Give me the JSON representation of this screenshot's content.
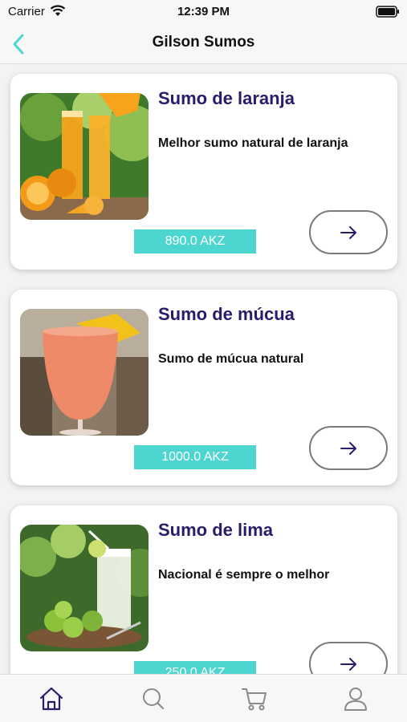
{
  "status_bar": {
    "carrier": "Carrier",
    "time": "12:39 PM"
  },
  "nav": {
    "title": "Gilson Sumos",
    "back_icon": "chevron-left-icon"
  },
  "products": [
    {
      "title": "Sumo de laranja",
      "description": "Melhor sumo natural de laranja",
      "price": "890.0 AKZ",
      "image": "orange-juice-photo"
    },
    {
      "title": "Sumo de múcua",
      "description": "Sumo de múcua natural",
      "price": "1000.0 AKZ",
      "image": "mucua-juice-photo"
    },
    {
      "title": "Sumo de lima",
      "description": "Nacional é sempre o melhor",
      "price": "250.0 AKZ",
      "image": "lime-juice-photo"
    }
  ],
  "tab_bar": {
    "tabs": [
      "home-icon",
      "search-icon",
      "cart-icon",
      "profile-icon"
    ]
  },
  "colors": {
    "accent": "#4dd6cf",
    "title": "#2b1b6b",
    "back": "#4dd6cf",
    "tab_active": "#2b1b6b"
  }
}
